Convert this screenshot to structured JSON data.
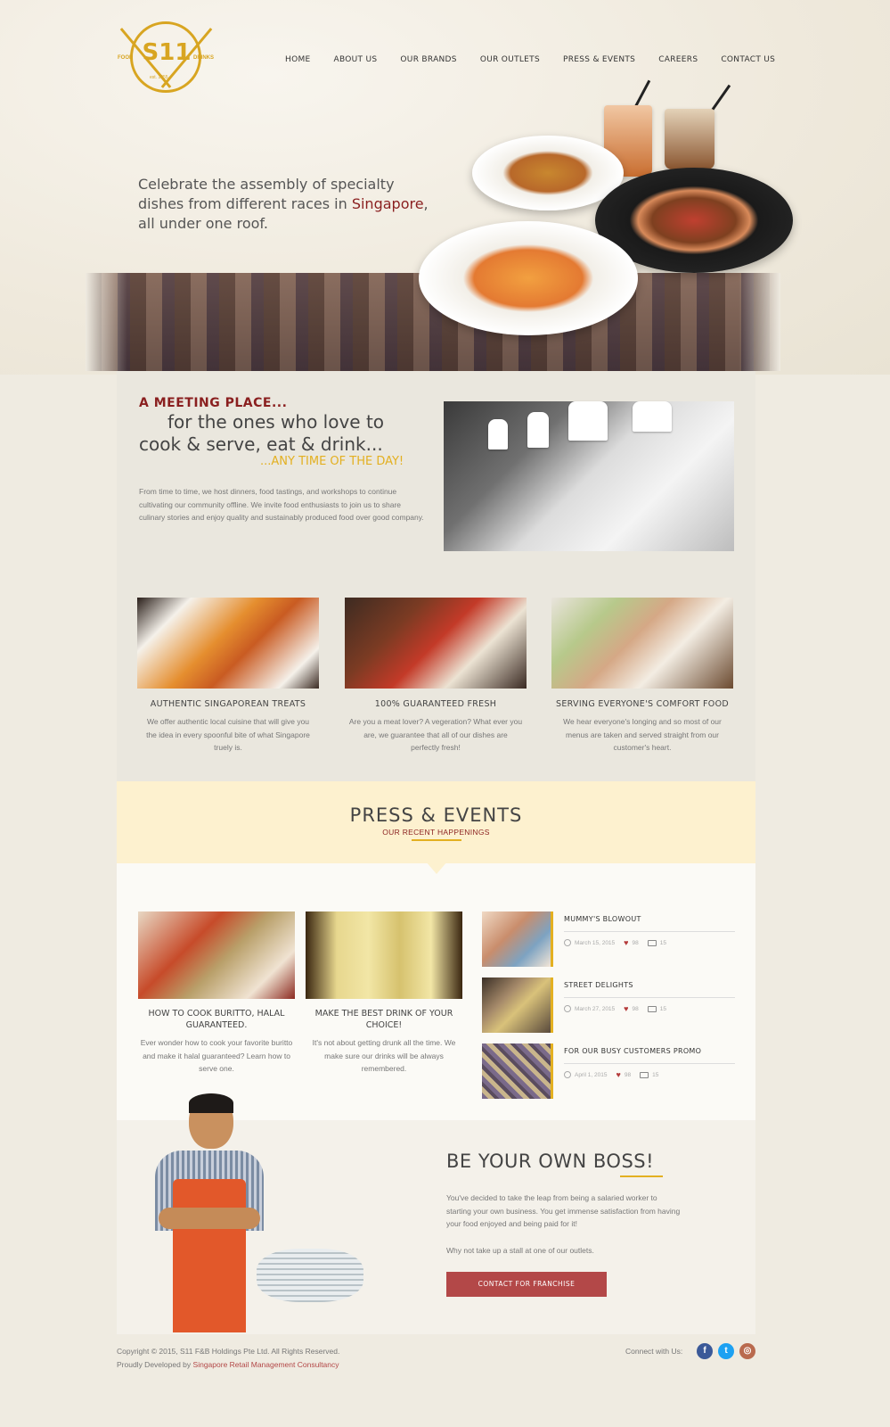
{
  "logo": {
    "name": "S11",
    "left_text": "FOOD",
    "right_text": "DRINKS",
    "est": "est. 1955"
  },
  "nav": {
    "items": [
      "HOME",
      "ABOUT US",
      "OUR BRANDS",
      "OUR OUTLETS",
      "PRESS & EVENTS",
      "CAREERS",
      "CONTACT US"
    ]
  },
  "hero": {
    "line1": "Celebrate the assembly of specialty",
    "line2": "dishes from different races in",
    "highlight": "Singapore",
    "line2_end": ",",
    "line3": "all under one roof."
  },
  "meeting": {
    "heading1": "A MEETING PLACE...",
    "heading2": "for the ones who love to",
    "heading3": "cook & serve, eat & drink...",
    "heading4": "...ANY TIME OF THE DAY!",
    "body": "From time to time, we host dinners, food tastings, and workshops to continue cultivating our community offline. We invite food enthusiasts to join us to share culinary stories and enjoy quality and sustainably produced food over good company."
  },
  "features": [
    {
      "title": "AUTHENTIC SINGAPOREAN TREATS",
      "desc": "We offer authentic local cuisine that will give you the idea in every spoonful bite of what Singapore truely is."
    },
    {
      "title": "100% GUARANTEED FRESH",
      "desc": "Are you a meat lover? A vegeration? What ever you are, we guarantee that all of our dishes are perfectly fresh!"
    },
    {
      "title": "SERVING EVERYONE'S COMFORT FOOD",
      "desc": "We hear everyone's longing and so most of our menus are taken and served straight from our customer's heart."
    }
  ],
  "press": {
    "title": "PRESS & EVENTS",
    "subtitle": "OUR RECENT HAPPENINGS"
  },
  "articles": [
    {
      "title": "HOW TO COOK BURITTO, HALAL GUARANTEED.",
      "desc": "Ever wonder how to cook your favorite buritto and make it halal guaranteed? Learn how to serve one."
    },
    {
      "title": "MAKE THE BEST DRINK OF YOUR CHOICE!",
      "desc": "It's not about getting drunk all the time. We make sure our drinks will be always remembered."
    }
  ],
  "events": [
    {
      "title": "MUMMY'S BLOWOUT",
      "date": "March 15, 2015",
      "likes": "98",
      "comments": "15"
    },
    {
      "title": "STREET DELIGHTS",
      "date": "March 27, 2015",
      "likes": "98",
      "comments": "15"
    },
    {
      "title": "FOR OUR BUSY CUSTOMERS PROMO",
      "date": "April 1, 2015",
      "likes": "98",
      "comments": "15"
    }
  ],
  "boss": {
    "title": "BE YOUR OWN BOSS!",
    "body1": "You've decided to take the leap from being a salaried worker to starting your own business. You get immense satisfaction from having your food enjoyed and being paid for it!",
    "body2": "Why not take up a stall at one of our outlets.",
    "button": "CONTACT FOR FRANCHISE"
  },
  "footer": {
    "copyright": "Copyright © 2015, S11 F&B Holdings Pte Ltd. All Rights Reserved.",
    "developed_prefix": "Proudly Developed by",
    "developed_link": "Singapore Retail Management Consultancy",
    "connect": "Connect with Us:",
    "social": [
      "facebook-icon",
      "twitter-icon",
      "instagram-icon"
    ]
  },
  "colors": {
    "accent_gold": "#e3b021",
    "accent_red": "#8a1f1f",
    "button_red": "#b34848",
    "press_band": "#fdf1cf"
  }
}
